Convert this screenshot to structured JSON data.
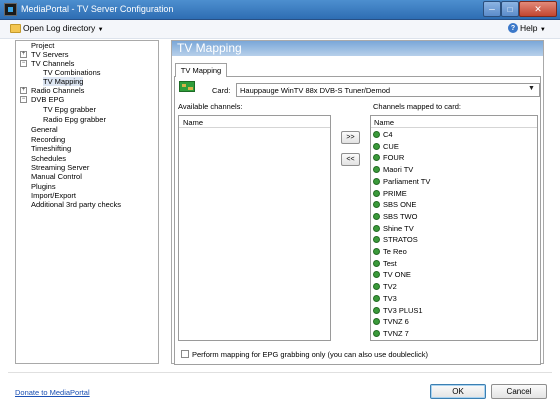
{
  "window": {
    "title": "MediaPortal - TV Server Configuration",
    "minimize_glyph": "─",
    "maximize_glyph": "□",
    "close_glyph": "✕"
  },
  "toolbar": {
    "open_log": "Open Log directory",
    "help": "Help"
  },
  "tree": {
    "expand_collapsed": "+",
    "expand_open": "−",
    "items": [
      {
        "label": "Project"
      },
      {
        "label": "TV Servers"
      },
      {
        "label": "TV Channels"
      },
      {
        "label": "TV Combinations"
      },
      {
        "label": "TV Mapping"
      },
      {
        "label": "Radio Channels"
      },
      {
        "label": "DVB EPG"
      },
      {
        "label": "TV Epg grabber"
      },
      {
        "label": "Radio Epg grabber"
      },
      {
        "label": "General"
      },
      {
        "label": "Recording"
      },
      {
        "label": "Timeshifting"
      },
      {
        "label": "Schedules"
      },
      {
        "label": "Streaming Server"
      },
      {
        "label": "Manual Control"
      },
      {
        "label": "Plugins"
      },
      {
        "label": "Import/Export"
      },
      {
        "label": "Additional 3rd party checks"
      }
    ]
  },
  "panel": {
    "header": "TV Mapping",
    "tab": "TV Mapping",
    "card_label": "Card:",
    "card_value": "Hauppauge WinTV 88x DVB-S Tuner/Demod",
    "available_label": "Available channels:",
    "mapped_label": "Channels mapped to card:",
    "column_name": "Name",
    "add_button": ">>",
    "remove_button": "<<",
    "epg_checkbox": "Perform mapping for EPG grabbing only (you can also use doubleclick)",
    "epg_checked": false
  },
  "mapped_channels": [
    "C4",
    "CUE",
    "FOUR",
    "Maori TV",
    "Parliament TV",
    "PRIME",
    "SBS ONE",
    "SBS TWO",
    "Shine TV",
    "STRATOS",
    "Te Reo",
    "Test",
    "TV ONE",
    "TV2",
    "TV3",
    "TV3 PLUS1",
    "TVNZ 6",
    "TVNZ 7"
  ],
  "available_channels": [],
  "footer": {
    "donate": "Donate to MediaPortal",
    "ok": "OK",
    "cancel": "Cancel"
  },
  "colors": {
    "titlebar": "#3d7fc4",
    "header_band": "#7aa7d8",
    "channel_icon": "#3a9a3a",
    "link": "#1a4fb3"
  },
  "icons": {
    "app": "mediaportal-app-icon",
    "open_log": "folder-icon",
    "help": "help-icon",
    "card": "tv-card-icon",
    "channel": "tv-channel-icon"
  }
}
